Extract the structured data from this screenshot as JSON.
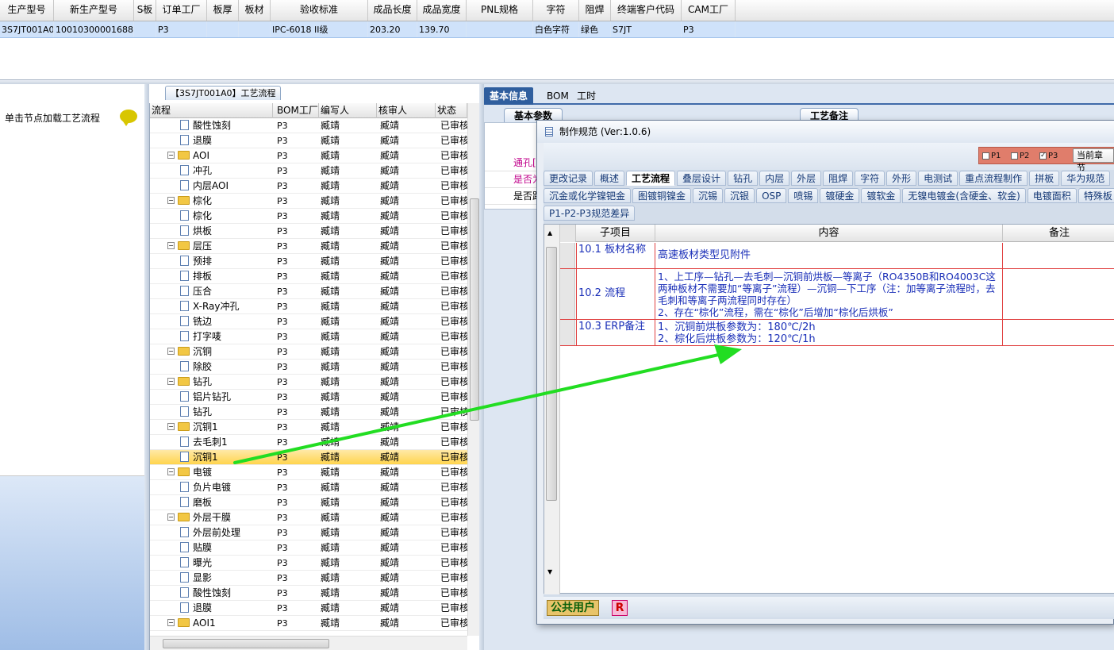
{
  "top_grid": {
    "headers": [
      "生产型号",
      "新生产型号",
      "S板",
      "订单工厂",
      "板厚",
      "板材",
      "验收标准",
      "成品长度",
      "成品宽度",
      "PNL规格",
      "字符",
      "阻焊",
      "终端客户代码",
      "CAM工厂"
    ],
    "row": [
      "3S7JT001A0",
      "10010300001688",
      "",
      "P3",
      "",
      "",
      "IPC-6018 II级",
      "203.20",
      "139.70",
      "",
      "白色字符",
      "绿色",
      "S7JT",
      "P3"
    ]
  },
  "left_pane": {
    "hint": "单击节点加载工艺流程",
    "tree_title": "【3S7JT001A0】工艺流程"
  },
  "tree": {
    "headers": [
      "流程",
      "BOM工厂",
      "编写人",
      "核审人",
      "状态"
    ],
    "rows": [
      {
        "name": "酸性蚀刻",
        "level": 1,
        "type": "doc",
        "bom": "P3",
        "writer": "臧靖",
        "reviewer": "臧靖",
        "status": "已审核"
      },
      {
        "name": "退膜",
        "level": 1,
        "type": "doc",
        "bom": "P3",
        "writer": "臧靖",
        "reviewer": "臧靖",
        "status": "已审核"
      },
      {
        "name": "AOI",
        "level": 0,
        "type": "folder",
        "bom": "P3",
        "writer": "臧靖",
        "reviewer": "臧靖",
        "status": "已审核"
      },
      {
        "name": "冲孔",
        "level": 1,
        "type": "doc",
        "bom": "P3",
        "writer": "臧靖",
        "reviewer": "臧靖",
        "status": "已审核"
      },
      {
        "name": "内层AOI",
        "level": 1,
        "type": "doc",
        "bom": "P3",
        "writer": "臧靖",
        "reviewer": "臧靖",
        "status": "已审核"
      },
      {
        "name": "棕化",
        "level": 0,
        "type": "folder",
        "bom": "P3",
        "writer": "臧靖",
        "reviewer": "臧靖",
        "status": "已审核"
      },
      {
        "name": "棕化",
        "level": 1,
        "type": "doc",
        "bom": "P3",
        "writer": "臧靖",
        "reviewer": "臧靖",
        "status": "已审核"
      },
      {
        "name": "烘板",
        "level": 1,
        "type": "doc",
        "bom": "P3",
        "writer": "臧靖",
        "reviewer": "臧靖",
        "status": "已审核"
      },
      {
        "name": "层压",
        "level": 0,
        "type": "folder",
        "bom": "P3",
        "writer": "臧靖",
        "reviewer": "臧靖",
        "status": "已审核"
      },
      {
        "name": "预排",
        "level": 1,
        "type": "doc",
        "bom": "P3",
        "writer": "臧靖",
        "reviewer": "臧靖",
        "status": "已审核"
      },
      {
        "name": "排板",
        "level": 1,
        "type": "doc",
        "bom": "P3",
        "writer": "臧靖",
        "reviewer": "臧靖",
        "status": "已审核"
      },
      {
        "name": "压合",
        "level": 1,
        "type": "doc",
        "bom": "P3",
        "writer": "臧靖",
        "reviewer": "臧靖",
        "status": "已审核"
      },
      {
        "name": "X-Ray冲孔",
        "level": 1,
        "type": "doc",
        "bom": "P3",
        "writer": "臧靖",
        "reviewer": "臧靖",
        "status": "已审核"
      },
      {
        "name": "铣边",
        "level": 1,
        "type": "doc",
        "bom": "P3",
        "writer": "臧靖",
        "reviewer": "臧靖",
        "status": "已审核"
      },
      {
        "name": "打字唛",
        "level": 1,
        "type": "doc",
        "bom": "P3",
        "writer": "臧靖",
        "reviewer": "臧靖",
        "status": "已审核"
      },
      {
        "name": "沉铜",
        "level": 0,
        "type": "folder",
        "bom": "P3",
        "writer": "臧靖",
        "reviewer": "臧靖",
        "status": "已审核"
      },
      {
        "name": "除胶",
        "level": 1,
        "type": "doc",
        "bom": "P3",
        "writer": "臧靖",
        "reviewer": "臧靖",
        "status": "已审核"
      },
      {
        "name": "钻孔",
        "level": 0,
        "type": "folder",
        "bom": "P3",
        "writer": "臧靖",
        "reviewer": "臧靖",
        "status": "已审核"
      },
      {
        "name": "铝片钻孔",
        "level": 1,
        "type": "doc",
        "bom": "P3",
        "writer": "臧靖",
        "reviewer": "臧靖",
        "status": "已审核"
      },
      {
        "name": "钻孔",
        "level": 1,
        "type": "doc",
        "bom": "P3",
        "writer": "臧靖",
        "reviewer": "臧靖",
        "status": "已审核"
      },
      {
        "name": "沉铜1",
        "level": 0,
        "type": "folder",
        "bom": "P3",
        "writer": "臧靖",
        "reviewer": "臧靖",
        "status": "已审核"
      },
      {
        "name": "去毛刺1",
        "level": 1,
        "type": "doc",
        "bom": "P3",
        "writer": "臧靖",
        "reviewer": "臧靖",
        "status": "已审核"
      },
      {
        "name": "沉铜1",
        "level": 1,
        "type": "doc",
        "bom": "P3",
        "writer": "臧靖",
        "reviewer": "臧靖",
        "status": "已审核",
        "selected": true
      },
      {
        "name": "电镀",
        "level": 0,
        "type": "folder",
        "bom": "P3",
        "writer": "臧靖",
        "reviewer": "臧靖",
        "status": "已审核"
      },
      {
        "name": "负片电镀",
        "level": 1,
        "type": "doc",
        "bom": "P3",
        "writer": "臧靖",
        "reviewer": "臧靖",
        "status": "已审核"
      },
      {
        "name": "磨板",
        "level": 1,
        "type": "doc",
        "bom": "P3",
        "writer": "臧靖",
        "reviewer": "臧靖",
        "status": "已审核"
      },
      {
        "name": "外层干膜",
        "level": 0,
        "type": "folder",
        "bom": "P3",
        "writer": "臧靖",
        "reviewer": "臧靖",
        "status": "已审核"
      },
      {
        "name": "外层前处理",
        "level": 1,
        "type": "doc",
        "bom": "P3",
        "writer": "臧靖",
        "reviewer": "臧靖",
        "status": "已审核"
      },
      {
        "name": "贴膜",
        "level": 1,
        "type": "doc",
        "bom": "P3",
        "writer": "臧靖",
        "reviewer": "臧靖",
        "status": "已审核"
      },
      {
        "name": "曝光",
        "level": 1,
        "type": "doc",
        "bom": "P3",
        "writer": "臧靖",
        "reviewer": "臧靖",
        "status": "已审核"
      },
      {
        "name": "显影",
        "level": 1,
        "type": "doc",
        "bom": "P3",
        "writer": "臧靖",
        "reviewer": "臧靖",
        "status": "已审核"
      },
      {
        "name": "酸性蚀刻",
        "level": 1,
        "type": "doc",
        "bom": "P3",
        "writer": "臧靖",
        "reviewer": "臧靖",
        "status": "已审核"
      },
      {
        "name": "退膜",
        "level": 1,
        "type": "doc",
        "bom": "P3",
        "writer": "臧靖",
        "reviewer": "臧靖",
        "status": "已审核"
      },
      {
        "name": "AOI1",
        "level": 0,
        "type": "folder",
        "bom": "P3",
        "writer": "臧靖",
        "reviewer": "臧靖",
        "status": "已审核"
      }
    ]
  },
  "right_pane": {
    "tabs": [
      "基本信息",
      "BOM",
      "工时"
    ],
    "sub_tabs": [
      "基本参数",
      "工艺备注"
    ],
    "rows": [
      "通孔[",
      "是否为",
      "是否跟"
    ]
  },
  "dialog": {
    "title": "制作规范 (Ver:1.0.6)",
    "checks": [
      {
        "label": "P1",
        "checked": false
      },
      {
        "label": "P2",
        "checked": false
      },
      {
        "label": "P3",
        "checked": true
      }
    ],
    "current_button": "当前章节",
    "cat_row1": [
      "更改记录",
      "概述",
      "工艺流程",
      "叠层设计",
      "钻孔",
      "内层",
      "外层",
      "阻焊",
      "字符",
      "外形",
      "电测试",
      "重点流程制作",
      "拼板",
      "华为规范"
    ],
    "cat_row1_active": "工艺流程",
    "cat_row2": [
      "沉金或化学镍钯金",
      "图镀铜镍金",
      "沉锡",
      "沉银",
      "OSP",
      "喷锡",
      "镀硬金",
      "镀软金",
      "无镍电镀金(含硬金、软金)",
      "电镀面积",
      "特殊板"
    ],
    "cat_row3": [
      "P1-P2-P3规范差异"
    ],
    "grid_headers": [
      "子项目",
      "内容",
      "备注"
    ],
    "grid_rows": [
      {
        "sub": "10.1 板材名称",
        "content": "高速板材类型见附件"
      },
      {
        "sub": "10.2 流程",
        "content": "1、上工序—钻孔—去毛刺—沉铜前烘板—等离子（RO4350B和RO4003C这两种板材不需要加“等离子”流程）—沉铜—下工序（注：加等离子流程时，去毛刺和等离子两流程同时存在）\n2、存在“棕化”流程，需在“棕化”后增加“棕化后烘板”"
      },
      {
        "sub": "10.3 ERP备注",
        "content": "1、沉铜前烘板参数为：180℃/2h\n2、棕化后烘板参数为：120℃/1h"
      }
    ],
    "status_user": "公共用户",
    "status_r": "R"
  },
  "colors": {
    "arrow": "#22dd22",
    "accent": "#2f5e9e",
    "selected_row": "#ffd44d",
    "grid_border": "#e04040",
    "content_text": "#1a2fb8"
  }
}
